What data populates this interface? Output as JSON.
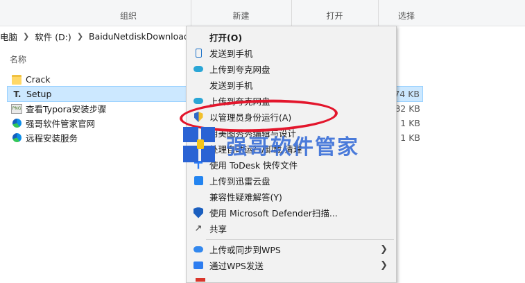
{
  "ribbon": {
    "groups": [
      "组织",
      "新建",
      "打开",
      "选择"
    ]
  },
  "address": {
    "crumbs": [
      "电脑",
      "软件 (D:)",
      "BaiduNetdiskDownload"
    ]
  },
  "filelist": {
    "column_name": "名称",
    "rows": [
      {
        "name": "Crack",
        "size": "",
        "icon": "folder-icon"
      },
      {
        "name": "Setup",
        "size": "74 KB",
        "icon": "typora-icon",
        "selected": true
      },
      {
        "name": "查看Typora安装步骤",
        "size": "82 KB",
        "icon": "png-icon"
      },
      {
        "name": "强哥软件管家官网",
        "size": "1 KB",
        "icon": "edge-icon"
      },
      {
        "name": "远程安装服务",
        "size": "1 KB",
        "icon": "edge-icon"
      }
    ]
  },
  "menu": {
    "items": [
      {
        "label": "打开(O)",
        "icon": ""
      },
      {
        "label": "发送到手机",
        "icon": "phone-icon"
      },
      {
        "label": "上传到夸克网盘",
        "icon": "cloud-icon"
      },
      {
        "label": "发送到手机",
        "icon": ""
      },
      {
        "label": "上传到夸克网盘",
        "icon": "cloud-icon"
      },
      {
        "label": "以管理员身份运行(A)",
        "icon": "uac-shield-icon"
      },
      {
        "label": "用美图秀秀编辑与设计",
        "icon": ""
      },
      {
        "label": "处理自动运行/卸载/清理",
        "icon": ""
      },
      {
        "label": "使用 ToDesk 快传文件",
        "icon": "todesk-icon"
      },
      {
        "label": "上传到迅雷云盘",
        "icon": "xunlei-icon"
      },
      {
        "label": "兼容性疑难解答(Y)",
        "icon": ""
      },
      {
        "label": "使用 Microsoft Defender扫描...",
        "icon": "defender-icon"
      },
      {
        "label": "共享",
        "icon": "share-icon"
      },
      {
        "label": "上传或同步到WPS",
        "icon": "wps-cloud-icon"
      },
      {
        "label": "通过WPS发送",
        "icon": "wps-send-icon"
      }
    ]
  },
  "watermark": {
    "text": "强哥软件管家"
  },
  "colors": {
    "selection": "#cce8ff",
    "annotation": "#e3162c",
    "watermark": "#3a6fd8"
  }
}
